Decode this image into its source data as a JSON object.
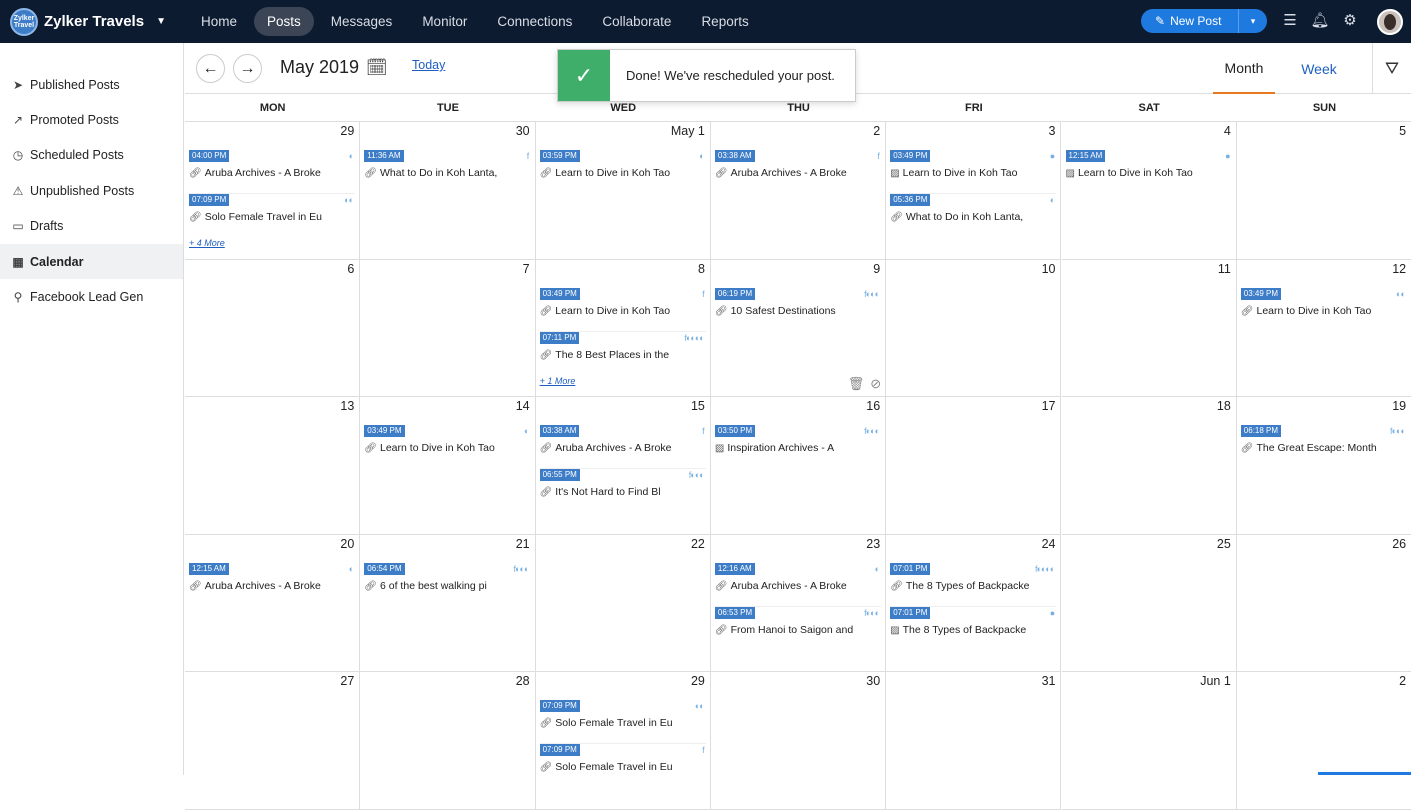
{
  "app": {
    "brand": "Zylker Travels",
    "logo_text": "Zylker Travel"
  },
  "nav": {
    "items": [
      "Home",
      "Posts",
      "Messages",
      "Monitor",
      "Connections",
      "Collaborate",
      "Reports"
    ],
    "active": "Posts",
    "new_post_label": "New Post"
  },
  "sidebar": {
    "items": [
      {
        "label": "Published Posts",
        "icon": "send-icon"
      },
      {
        "label": "Promoted Posts",
        "icon": "promote-icon"
      },
      {
        "label": "Scheduled Posts",
        "icon": "clock-icon"
      },
      {
        "label": "Unpublished Posts",
        "icon": "warning-icon"
      },
      {
        "label": "Drafts",
        "icon": "drafts-icon"
      },
      {
        "label": "Calendar",
        "icon": "calendar-icon"
      },
      {
        "label": "Facebook Lead Gen",
        "icon": "lead-gen-icon"
      }
    ],
    "active": "Calendar"
  },
  "calendar": {
    "month_title": "May 2019",
    "today_label": "Today",
    "view_month": "Month",
    "view_week": "Week",
    "weekdays": [
      "MON",
      "TUE",
      "WED",
      "THU",
      "FRI",
      "SAT",
      "SUN"
    ],
    "weeks": [
      [
        {
          "day": "29",
          "posts": [
            {
              "time": "04:00 PM",
              "title": "Aruba Archives - A Broke",
              "type": "link",
              "nets": "◐"
            },
            {
              "time": "07:09 PM",
              "title": "Solo Female Travel in Eu",
              "type": "link",
              "nets": "◐◐"
            }
          ],
          "more": "+ 4 More"
        },
        {
          "day": "30",
          "posts": [
            {
              "time": "11:36 AM",
              "title": "What to Do in Koh Lanta,",
              "type": "link",
              "nets": "f"
            }
          ]
        },
        {
          "day": "May 1",
          "posts": [
            {
              "time": "03:59 PM",
              "title": "Learn to Dive in Koh Tao",
              "type": "link",
              "nets": "◐"
            }
          ]
        },
        {
          "day": "2",
          "posts": [
            {
              "time": "03:38 AM",
              "title": "Aruba Archives - A Broke",
              "type": "link",
              "nets": "f"
            }
          ]
        },
        {
          "day": "3",
          "posts": [
            {
              "time": "03:49 PM",
              "title": "Learn to Dive in Koh Tao",
              "type": "image",
              "nets": "●"
            },
            {
              "time": "05:36 PM",
              "title": "What to Do in Koh Lanta,",
              "type": "link",
              "nets": "◐"
            }
          ]
        },
        {
          "day": "4",
          "posts": [
            {
              "time": "12:15 AM",
              "title": "Learn to Dive in Koh Tao",
              "type": "image",
              "nets": "●"
            }
          ]
        },
        {
          "day": "5",
          "posts": []
        }
      ],
      [
        {
          "day": "6",
          "posts": []
        },
        {
          "day": "7",
          "posts": []
        },
        {
          "day": "8",
          "posts": [
            {
              "time": "03:49 PM",
              "title": "Learn to Dive in Koh Tao",
              "type": "link",
              "nets": "f"
            },
            {
              "time": "07:11 PM",
              "title": "The 8 Best Places in the",
              "type": "link",
              "nets": "f◐◐◐◐"
            }
          ],
          "more": "+ 1 More"
        },
        {
          "day": "9",
          "posts": [
            {
              "time": "06:19 PM",
              "title": "10 Safest Destinations",
              "type": "link",
              "nets": "f◐◐◐"
            }
          ],
          "actions": true
        },
        {
          "day": "10",
          "posts": []
        },
        {
          "day": "11",
          "posts": []
        },
        {
          "day": "12",
          "posts": [
            {
              "time": "03:49 PM",
              "title": "Learn to Dive in Koh Tao",
              "type": "link",
              "nets": "◐◐"
            }
          ]
        }
      ],
      [
        {
          "day": "13",
          "posts": []
        },
        {
          "day": "14",
          "posts": [
            {
              "time": "03:49 PM",
              "title": "Learn to Dive in Koh Tao",
              "type": "link",
              "nets": "◐"
            }
          ]
        },
        {
          "day": "15",
          "posts": [
            {
              "time": "03:38 AM",
              "title": "Aruba Archives - A Broke",
              "type": "link",
              "nets": "f"
            },
            {
              "time": "06:55 PM",
              "title": "It's Not Hard to Find Bl",
              "type": "link",
              "nets": "f◐◐◐"
            }
          ]
        },
        {
          "day": "16",
          "posts": [
            {
              "time": "03:50 PM",
              "title": "Inspiration Archives - A",
              "type": "image",
              "nets": "f◐◐◐"
            }
          ]
        },
        {
          "day": "17",
          "posts": []
        },
        {
          "day": "18",
          "posts": []
        },
        {
          "day": "19",
          "posts": [
            {
              "time": "06:18 PM",
              "title": "The Great Escape: Month",
              "type": "link",
              "nets": "f◐◐◐"
            }
          ]
        }
      ],
      [
        {
          "day": "20",
          "posts": [
            {
              "time": "12:15 AM",
              "title": "Aruba Archives - A Broke",
              "type": "link",
              "nets": "◐"
            }
          ]
        },
        {
          "day": "21",
          "posts": [
            {
              "time": "06:54 PM",
              "title": "6 of the best walking pi",
              "type": "link",
              "nets": "f◐◐◐"
            }
          ]
        },
        {
          "day": "22",
          "posts": []
        },
        {
          "day": "23",
          "posts": [
            {
              "time": "12:16 AM",
              "title": "Aruba Archives - A Broke",
              "type": "link",
              "nets": "◐"
            },
            {
              "time": "06:53 PM",
              "title": "From Hanoi to Saigon and",
              "type": "link",
              "nets": "f◐◐◐"
            }
          ]
        },
        {
          "day": "24",
          "posts": [
            {
              "time": "07:01 PM",
              "title": "The 8 Types of Backpacke",
              "type": "link",
              "nets": "f◐◐◐◐"
            },
            {
              "time": "07:01 PM",
              "title": "The 8 Types of Backpacke",
              "type": "image",
              "nets": "●"
            }
          ]
        },
        {
          "day": "25",
          "posts": []
        },
        {
          "day": "26",
          "posts": []
        }
      ],
      [
        {
          "day": "27",
          "posts": []
        },
        {
          "day": "28",
          "posts": []
        },
        {
          "day": "29",
          "posts": [
            {
              "time": "07:09 PM",
              "title": "Solo Female Travel in Eu",
              "type": "link",
              "nets": "◐◐"
            },
            {
              "time": "07:09 PM",
              "title": "Solo Female Travel in Eu",
              "type": "link",
              "nets": "f"
            }
          ]
        },
        {
          "day": "30",
          "posts": []
        },
        {
          "day": "31",
          "posts": []
        },
        {
          "day": "Jun 1",
          "posts": []
        },
        {
          "day": "2",
          "posts": []
        }
      ]
    ]
  },
  "toast": {
    "message": "Done! We've rescheduled your post."
  },
  "colors": {
    "topbar": "#0d1b30",
    "accent": "#1f7ae0",
    "time_badge": "#3d7cc7",
    "toast_success": "#3fae6a",
    "active_tab_underline": "#e8791e"
  }
}
